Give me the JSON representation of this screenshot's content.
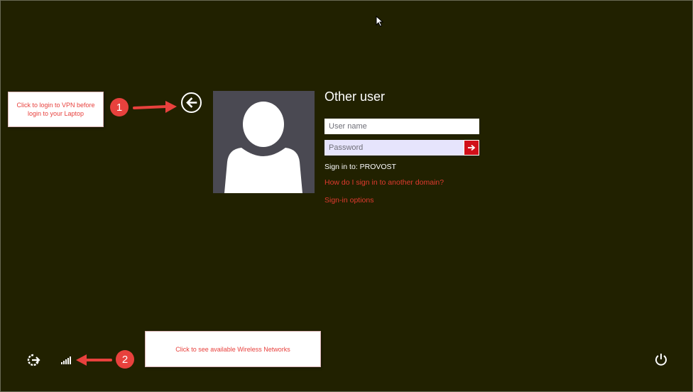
{
  "login": {
    "user_title": "Other user",
    "username_placeholder": "User name",
    "password_placeholder": "Password",
    "sign_in_to": "Sign in to: PROVOST",
    "link_other_domain": "How do I sign in to another domain?",
    "link_signin_options": "Sign-in options"
  },
  "annotations": {
    "callout_1": "Click to login to VPN before login to your Laptop",
    "badge_1": "1",
    "callout_2": "Click to see available Wireless Networks",
    "badge_2": "2"
  },
  "icons": {
    "back": "back-arrow-circle-icon",
    "submit": "right-arrow-icon",
    "avatar": "user-silhouette-icon",
    "ease_of_access": "ease-of-access-icon",
    "network": "wireless-signal-icon",
    "power": "power-icon"
  },
  "colors": {
    "background": "#212100",
    "accent": "#d10f19",
    "link": "#e03a2e",
    "annotation": "#e8413d"
  }
}
